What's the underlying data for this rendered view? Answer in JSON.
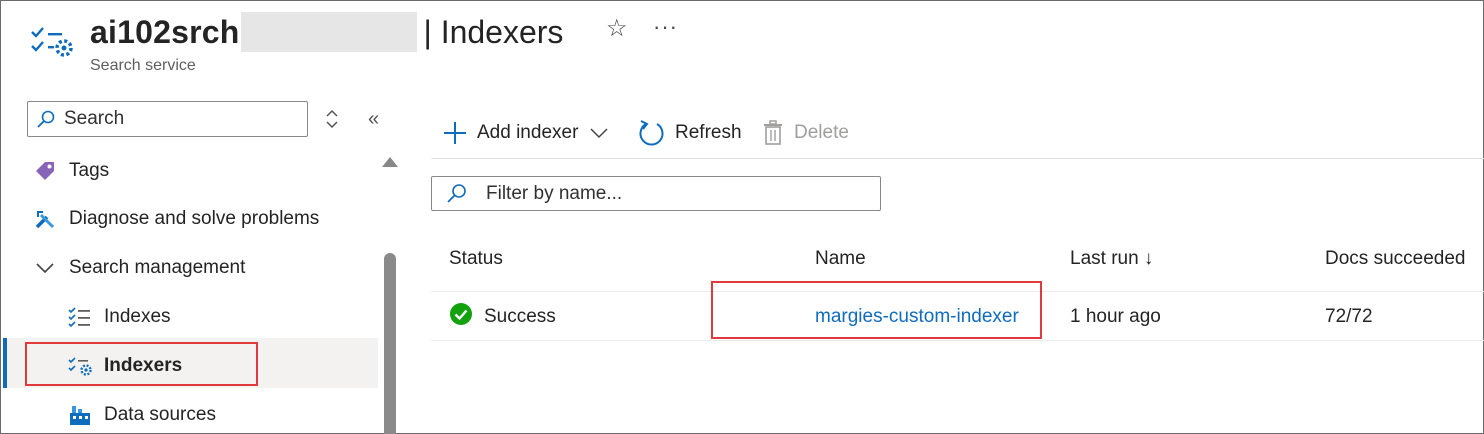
{
  "header": {
    "service_name": "ai102srch",
    "page_title": "| Indexers",
    "subtitle": "Search service",
    "star_glyph": "☆",
    "more_glyph": "···"
  },
  "sidebar": {
    "search_placeholder": "Search",
    "collapse_glyph": "«",
    "items": [
      {
        "label": "Tags",
        "icon": "tag-icon"
      },
      {
        "label": "Diagnose and solve problems",
        "icon": "wrench-icon"
      },
      {
        "label": "Search management",
        "icon": "chevron-down-icon"
      },
      {
        "label": "Indexes",
        "icon": "list-icon"
      },
      {
        "label": "Indexers",
        "icon": "indexer-icon",
        "selected": true
      },
      {
        "label": "Data sources",
        "icon": "datasource-icon"
      }
    ]
  },
  "toolbar": {
    "add_label": "Add indexer",
    "refresh_label": "Refresh",
    "delete_label": "Delete"
  },
  "filter": {
    "placeholder": "Filter by name..."
  },
  "table": {
    "columns": [
      "Status",
      "Name",
      "Last run ↓",
      "Docs succeeded"
    ],
    "rows": [
      {
        "status": "Success",
        "name": "margies-custom-indexer",
        "last_run": "1 hour ago",
        "docs": "72/72"
      }
    ]
  },
  "colors": {
    "accent": "#0f6cbd",
    "success": "#13a10e",
    "highlight": "#e0393e"
  }
}
